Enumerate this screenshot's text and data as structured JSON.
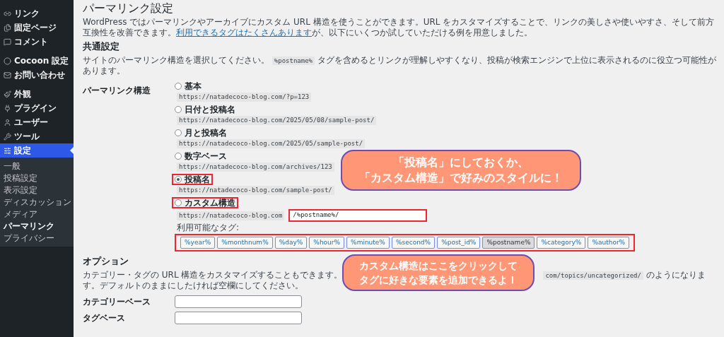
{
  "sidebar": {
    "items": [
      {
        "label": "リンク",
        "selected": false
      },
      {
        "label": "固定ページ",
        "selected": false
      },
      {
        "label": "コメント",
        "selected": false
      },
      {
        "label": "Cocoon 設定",
        "selected": false
      },
      {
        "label": "お問い合わせ",
        "selected": false
      },
      {
        "label": "外観",
        "selected": false
      },
      {
        "label": "プラグイン",
        "selected": false
      },
      {
        "label": "ユーザー",
        "selected": false
      },
      {
        "label": "ツール",
        "selected": false
      },
      {
        "label": "設定",
        "selected": true
      }
    ],
    "submenu": [
      {
        "label": "一般",
        "selected": false
      },
      {
        "label": "投稿設定",
        "selected": false
      },
      {
        "label": "表示設定",
        "selected": false
      },
      {
        "label": "ディスカッション",
        "selected": false
      },
      {
        "label": "メディア",
        "selected": false
      },
      {
        "label": "パーマリンク",
        "selected": true
      },
      {
        "label": "プライバシー",
        "selected": false
      }
    ]
  },
  "page": {
    "title": "パーマリンク設定",
    "intro": "WordPress ではパーマリンクやアーカイブにカスタム URL 構造を使うことができます。URL をカスタマイズすることで、リンクの美しさや使いやすさ、そして前方互換性を改善できます。",
    "intro_link": "利用できるタグはたくさんあります",
    "intro_end": "が、以下にいくつか試していただける例を用意しました。",
    "common": {
      "heading": "共通設定",
      "desc_start": "サイトのパーマリンク構造を選択してください。",
      "desc_code": "%postname%",
      "desc_end": "タグを含めるとリンクが理解しやすくなり、投稿が検索エンジンで上位に表示されるのに役立つ可能性があります。",
      "label": "パーマリンク構造",
      "options": [
        {
          "kind": "preset",
          "label": "基本",
          "url": "https://natadecoco-blog.com/?p=123",
          "selected": false,
          "highlighted": false
        },
        {
          "kind": "preset",
          "label": "日付と投稿名",
          "url": "https://natadecoco-blog.com/2025/05/08/sample-post/",
          "selected": false,
          "highlighted": false
        },
        {
          "kind": "preset",
          "label": "月と投稿名",
          "url": "https://natadecoco-blog.com/2025/05/sample-post/",
          "selected": false,
          "highlighted": false
        },
        {
          "kind": "preset",
          "label": "数字ベース",
          "url": "https://natadecoco-blog.com/archives/123",
          "selected": false,
          "highlighted": false
        },
        {
          "kind": "preset",
          "label": "投稿名",
          "url": "https://natadecoco-blog.com/sample-post/",
          "selected": true,
          "highlighted": true
        },
        {
          "kind": "custom",
          "label": "カスタム構造",
          "url": "https://natadecoco-blog.com",
          "value": "/%postname%/",
          "selected": false,
          "highlighted": true,
          "field_highlighted": true
        }
      ],
      "tags_label": "利用可能なタグ:",
      "tags_highlighted": true,
      "tags": [
        {
          "label": "%year%",
          "selected": false
        },
        {
          "label": "%monthnum%",
          "selected": false
        },
        {
          "label": "%day%",
          "selected": false
        },
        {
          "label": "%hour%",
          "selected": false
        },
        {
          "label": "%minute%",
          "selected": false
        },
        {
          "label": "%second%",
          "selected": false
        },
        {
          "label": "%post_id%",
          "selected": false
        },
        {
          "label": "%postname%",
          "selected": true
        },
        {
          "label": "%category%",
          "selected": false
        },
        {
          "label": "%author%",
          "selected": false
        }
      ]
    },
    "optional": {
      "heading": "オプション",
      "desc_start": "カテゴリー・タグの URL 構造をカスタマイズすることもできます。",
      "desc_code": "com/topics/uncategorized/",
      "desc_end": "のようになります。デフォルトのままにしたければ空欄にしてください。",
      "fields": [
        {
          "label": "カテゴリーベース"
        },
        {
          "label": "タグベース"
        }
      ]
    }
  },
  "callouts": [
    {
      "lines": [
        "「投稿名」にしておくか、",
        "「カスタム構造」で好みのスタイルに！"
      ]
    },
    {
      "lines": [
        "カスタム構造はここをクリックして",
        "タグに好きな要素を追加できるよ！"
      ]
    }
  ]
}
